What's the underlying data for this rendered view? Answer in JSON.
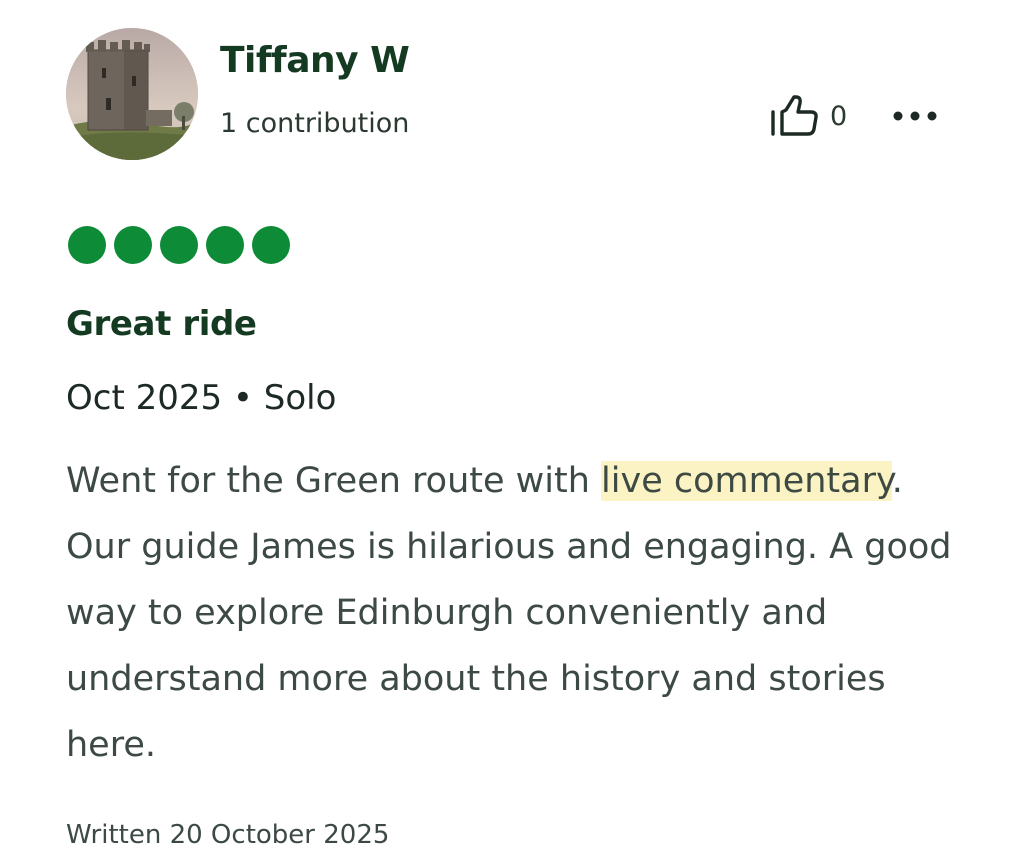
{
  "author": {
    "name": "Tiffany W",
    "contributions": "1 contribution"
  },
  "helpful": {
    "count": "0",
    "icon": "thumbs-up-icon"
  },
  "more_icon": "more-dots-icon",
  "rating": {
    "value": 5,
    "max": 5,
    "color": "#0e8b37"
  },
  "review": {
    "title": "Great ride",
    "meta": "Oct 2025 • Solo",
    "text_before": "Went for the Green route with ",
    "highlight": "live commentary",
    "text_after": ". Our guide James is hilarious and engaging. A good way to explore Edinburgh conveniently and understand more about the history and stories here.",
    "written": "Written 20 October 2025"
  },
  "colors": {
    "highlight": "#fcf3c4",
    "heading": "#143a22"
  }
}
